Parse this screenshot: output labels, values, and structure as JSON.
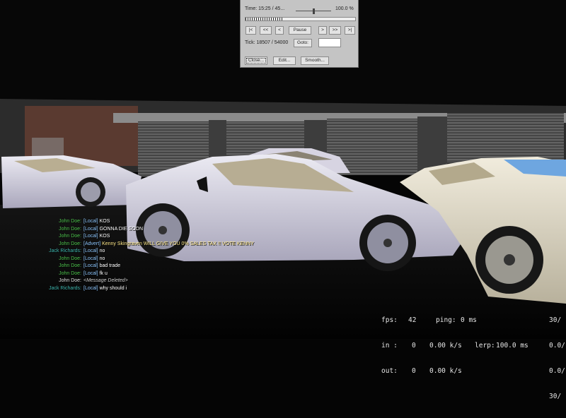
{
  "demo_ui": {
    "time_label": "Time: 15:25 / 45...",
    "speed_label": "100.0 %",
    "speed_fraction": 0.5,
    "progress_fraction": 0.34,
    "first_label": "|<",
    "rewind_label": "<<",
    "step_back_label": "<",
    "pause_label": "Pause",
    "step_forward_label": ">",
    "fast_forward_label": ">>",
    "last_label": ">|",
    "tick_label": "Tick: 18507 / 54000",
    "goto_label": "Goto:",
    "goto_value": "",
    "close_label": "Close...",
    "edit_label": "Edit...",
    "smooth_label": "Smooth..."
  },
  "chat": [
    {
      "name": "John Doe:",
      "name_color": "#4fc64f",
      "tag": "[Local]",
      "text": "KOS",
      "kind": "local"
    },
    {
      "name": "John Doe:",
      "name_color": "#4fc64f",
      "tag": "[Local]",
      "text": "GONNA DIE SOON",
      "kind": "local"
    },
    {
      "name": "John Doe:",
      "name_color": "#4fc64f",
      "tag": "[Local]",
      "text": "KOS",
      "kind": "local"
    },
    {
      "name": "John Doe:",
      "name_color": "#4fc64f",
      "tag": "[Advert]",
      "text": "Kenny Skingraven WILL GIVE YOU 0% SALES TAX !! VOTE KENNY",
      "kind": "advert"
    },
    {
      "name": "Jack Richards:",
      "name_color": "#3fb8b0",
      "tag": "[Local]",
      "text": "no",
      "kind": "local"
    },
    {
      "name": "John Doe:",
      "name_color": "#4fc64f",
      "tag": "[Local]",
      "text": "no",
      "kind": "local"
    },
    {
      "name": "John Doe:",
      "name_color": "#4fc64f",
      "tag": "[Local]",
      "text": "bad trade",
      "kind": "local"
    },
    {
      "name": "John Doe:",
      "name_color": "#4fc64f",
      "tag": "[Local]",
      "text": "fk u",
      "kind": "local"
    },
    {
      "name": "John Doe:",
      "name_color": "#e0e0e0",
      "tag": "",
      "text": "<Message Deleted>",
      "kind": "deleted"
    },
    {
      "name": "Jack Richards:",
      "name_color": "#3fb8b0",
      "tag": "[Local]",
      "text": "why should i",
      "kind": "local"
    }
  ],
  "netgraph": {
    "fps_label": "fps:",
    "fps_value": "42",
    "ping_label": "ping:",
    "ping_value": "0 ms",
    "in_label": "in :",
    "in_value": "0",
    "in_rate": "0.00 k/s",
    "lerp_label": "lerp:",
    "lerp_value": "100.0 ms",
    "out_label": "out:",
    "out_value": "0",
    "out_rate": "0.00 k/s",
    "right_col": [
      "30/",
      "0.0/",
      "0.0/",
      "30/"
    ]
  },
  "colors": {
    "sky": "#050505",
    "building": "#3b3b3b",
    "shutter": "#6a6a6a",
    "car_white": "#d9d6e4",
    "car_cream": "#e4dfcf"
  }
}
